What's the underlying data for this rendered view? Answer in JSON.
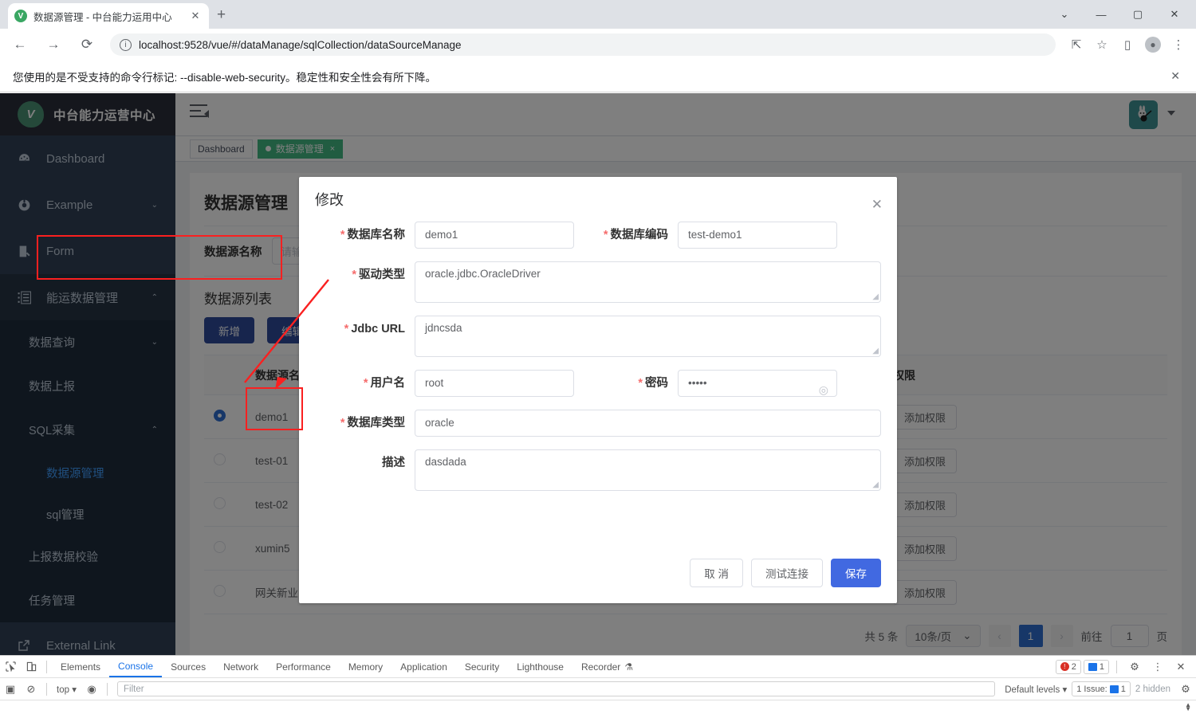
{
  "browser": {
    "tab_title": "数据源管理 - 中台能力运用中心",
    "favicon_letter": "V",
    "tab_close": "✕",
    "new_tab": "+",
    "window_minimize": "—",
    "window_maximize": "▢",
    "window_close": "✕",
    "window_dropdown": "⌄",
    "back": "←",
    "forward": "→",
    "reload": "⟳",
    "url": "localhost:9528/vue/#/dataManage/sqlCollection/dataSourceManage",
    "info_icon": "i",
    "share_icon": "⇱",
    "bookmark_icon": "☆",
    "sidepanel_icon": "▯",
    "profile_icon": "●",
    "menu_icon": "⋮",
    "warning_text": "您使用的是不受支持的命令行标记: --disable-web-security。稳定性和安全性会有所下降。",
    "warning_close": "✕"
  },
  "sidebar": {
    "logo_letter": "V",
    "logo_text": "中台能力运营中心",
    "items": [
      {
        "label": "Dashboard",
        "icon": "dashboard-icon",
        "arrow": ""
      },
      {
        "label": "Example",
        "icon": "example-icon",
        "arrow": "⌄"
      },
      {
        "label": "Form",
        "icon": "form-icon",
        "arrow": ""
      },
      {
        "label": "能运数据管理",
        "icon": "data-management-icon",
        "arrow": "⌃"
      }
    ],
    "sub_items": [
      {
        "label": "数据查询",
        "arrow": "⌄"
      },
      {
        "label": "数据上报",
        "arrow": ""
      },
      {
        "label": "SQL采集",
        "arrow": "⌃"
      }
    ],
    "sub2_items": [
      {
        "label": "数据源管理",
        "active": true
      },
      {
        "label": "sql管理",
        "active": false
      }
    ],
    "tail_items": [
      {
        "label": "上报数据校验"
      },
      {
        "label": "任务管理"
      }
    ],
    "external": {
      "label": "External Link",
      "icon": "external-link-icon"
    }
  },
  "navbar": {
    "hamburger": "hamburger-icon",
    "avatar": "avatar",
    "caret": "▾"
  },
  "tags": [
    {
      "label": "Dashboard",
      "selected": false,
      "closable": false
    },
    {
      "label": "数据源管理",
      "selected": true,
      "closable": true,
      "close": "×"
    }
  ],
  "main": {
    "page_title": "数据源管理",
    "search_label": "数据源名称",
    "search_placeholder": "请输入",
    "search_value": "",
    "list_title": "数据源列表",
    "buttons": {
      "add": "新增",
      "edit": "编辑"
    },
    "table": {
      "columns": [
        "",
        "数据源名称",
        "权限"
      ],
      "rows": [
        {
          "selected": true,
          "name": "demo1",
          "perm": "添加权限"
        },
        {
          "selected": false,
          "name": "test-01",
          "perm": "添加权限"
        },
        {
          "selected": false,
          "name": "test-02",
          "perm": "添加权限"
        },
        {
          "selected": false,
          "name": "xumin5",
          "perm": "添加权限"
        },
        {
          "selected": false,
          "name": "网关新业",
          "perm": "添加权限"
        }
      ]
    },
    "pagination": {
      "total": "共 5 条",
      "page_size": "10条/页",
      "page_size_caret": "⌄",
      "prev": "‹",
      "next": "›",
      "current_page": "1",
      "goto_label": "前往",
      "goto_value": "1",
      "goto_suffix": "页"
    }
  },
  "modal": {
    "title": "修改",
    "close": "✕",
    "fields": [
      {
        "label": "数据库名称",
        "required": true,
        "value": "demo1",
        "type": "input-half"
      },
      {
        "label": "数据库编码",
        "required": true,
        "value": "test-demo1",
        "type": "input-half"
      },
      {
        "label": "驱动类型",
        "required": true,
        "value": "oracle.jdbc.OracleDriver",
        "type": "textarea"
      },
      {
        "label": "Jdbc URL",
        "required": true,
        "value": "jdncsda",
        "type": "textarea"
      },
      {
        "label": "用户名",
        "required": true,
        "value": "root",
        "type": "input-half"
      },
      {
        "label": "密码",
        "required": true,
        "value": "•••••",
        "type": "password"
      },
      {
        "label": "数据库类型",
        "required": true,
        "value": "oracle",
        "type": "input"
      },
      {
        "label": "描述",
        "required": false,
        "value": "dasdada",
        "type": "textarea"
      }
    ],
    "password_eye": "◎",
    "footer": {
      "cancel": "取 消",
      "test": "测试连接",
      "save": "保存"
    }
  },
  "devtools": {
    "inspect_icon": "⌖",
    "device_icon": "▯",
    "tabs": [
      "Elements",
      "Console",
      "Sources",
      "Network",
      "Performance",
      "Memory",
      "Application",
      "Security",
      "Lighthouse",
      "Recorder"
    ],
    "active_tab": "Console",
    "recorder_badge": "⚗",
    "error_count": "2",
    "message_count": "1",
    "settings_icon": "⚙",
    "kebab_icon": "⋮",
    "close_icon": "✕",
    "exec_icon": "▣",
    "clear_icon": "⊘",
    "context": "top",
    "context_caret": "▾",
    "eye_icon": "◉",
    "filter_placeholder": "Filter",
    "levels": "Default levels",
    "levels_caret": "▾",
    "issues": "1 Issue:",
    "issues_count": "1",
    "hidden": "2 hidden",
    "gear2": "⚙"
  },
  "colors": {
    "brand_green": "#42b983",
    "sidebar_bg": "#304156",
    "primary_blue": "#2f6fd0",
    "modal_save": "#4169e1",
    "annotation_red": "#fa2020",
    "active_link": "#409eff"
  }
}
